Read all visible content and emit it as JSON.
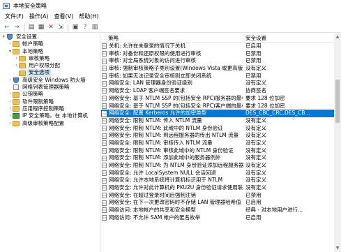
{
  "window": {
    "title": "本地安全策略"
  },
  "menu": [
    "文件(F)",
    "操作(A)",
    "查看(V)",
    "帮助(H)"
  ],
  "toolbar": [
    {
      "name": "back-button",
      "glyph": "←"
    },
    {
      "name": "forward-button",
      "glyph": "→"
    },
    {
      "name": "up-folder-button",
      "glyph": "▤"
    },
    {
      "name": "show-tree-button",
      "glyph": "▦"
    },
    {
      "name": "delete-button",
      "glyph": "✕"
    },
    {
      "name": "export-list-button",
      "glyph": "⇲"
    },
    {
      "name": "properties-button",
      "glyph": "▣"
    },
    {
      "name": "help-button",
      "glyph": "?"
    },
    {
      "name": "view-button",
      "glyph": "▥"
    }
  ],
  "tree": [
    {
      "label": "安全设置",
      "indent": 0,
      "arrow": "▾",
      "icon": "shield"
    },
    {
      "label": "帐户策略",
      "indent": 1,
      "arrow": "›",
      "icon": "folder"
    },
    {
      "label": "本地策略",
      "indent": 1,
      "arrow": "▾",
      "icon": "folder"
    },
    {
      "label": "审核策略",
      "indent": 2,
      "arrow": "›",
      "icon": "folder"
    },
    {
      "label": "用户权限分配",
      "indent": 2,
      "arrow": "›",
      "icon": "folder"
    },
    {
      "label": "安全选项",
      "indent": 2,
      "arrow": "",
      "icon": "folder",
      "selected": true
    },
    {
      "label": "高级安全 Windows 防火墙",
      "indent": 1,
      "arrow": "›",
      "icon": "shield"
    },
    {
      "label": "网络列表管理器策略",
      "indent": 1,
      "arrow": "",
      "icon": "doc"
    },
    {
      "label": "公钥策略",
      "indent": 1,
      "arrow": "›",
      "icon": "folder"
    },
    {
      "label": "软件限制策略",
      "indent": 1,
      "arrow": "›",
      "icon": "folder"
    },
    {
      "label": "应用程序控制策略",
      "indent": 1,
      "arrow": "›",
      "icon": "folder"
    },
    {
      "label": "IP 安全策略，在 本地计算机",
      "indent": 1,
      "arrow": "›",
      "icon": "net"
    },
    {
      "label": "高级审核策略配置",
      "indent": 1,
      "arrow": "›",
      "icon": "folder"
    }
  ],
  "columns": {
    "policy": "策略",
    "setting": "安全设置"
  },
  "rows": [
    {
      "policy": "关机: 允许在未登录的情况下关机",
      "setting": "已启用"
    },
    {
      "policy": "审核: 对备份和还原权限的使用进行审核",
      "setting": "已禁用"
    },
    {
      "policy": "审核: 对全局系统对象的访问进行审核",
      "setting": "已禁用"
    },
    {
      "policy": "审核: 强制审核策略子类别设置(Windows Vista 或更高版本)...",
      "setting": "没有定义"
    },
    {
      "policy": "审核: 如果无法记录安全审核则立即关闭系统",
      "setting": "已禁用"
    },
    {
      "policy": "网络安全: LAN 管理器身份验证级别",
      "setting": "没有定义"
    },
    {
      "policy": "网络安全: LDAP 客户端签名要求",
      "setting": "协商签名"
    },
    {
      "policy": "网络安全: 基于 NTLM SSP 的(包括安全 RPC)服务器的最小...",
      "setting": "要求 128 位加密"
    },
    {
      "policy": "网络安全: 基于 NTLM SSP 的(包括安全 RPC)客户端的最小...",
      "setting": "要求 128 位加密"
    },
    {
      "policy": "网络安全: 配置 Kerberos 允许的加密类型",
      "setting": "DES_CBC_CRC,DES_CB...",
      "selected": true
    },
    {
      "policy": "网络安全: 限制 NTLM: 传入 NTLM 流量",
      "setting": "没有定义"
    },
    {
      "policy": "网络安全: 限制 NTLM: 此域中的 NTLM 身份验证",
      "setting": "没有定义"
    },
    {
      "policy": "网络安全: 限制 NTLM: 到远程服务器的传出 NTLM 流量",
      "setting": "没有定义"
    },
    {
      "policy": "网络安全: 限制 NTLM: 审核传入 NTLM 流量",
      "setting": "没有定义"
    },
    {
      "policy": "网络安全: 限制 NTLM: 审核此域中的 NTLM 身份验证",
      "setting": "没有定义"
    },
    {
      "policy": "网络安全: 限制 NTLM: 添加此域中的服务器例外",
      "setting": "没有定义"
    },
    {
      "policy": "网络安全: 限制 NTLM: 为 NTLM 身份验证添加远程服务器...",
      "setting": "没有定义"
    },
    {
      "policy": "网络安全: 允许 LocalSystem NULL 会话回退",
      "setting": "没有定义"
    },
    {
      "policy": "网络安全: 允许本地系统将计算机标识用于 NTLM",
      "setting": "没有定义"
    },
    {
      "policy": "网络安全: 允许对此计算机的 PKU2U 身份验证请求使用联机...",
      "setting": "没有定义"
    },
    {
      "policy": "网络安全: 在超过登录时间后强制注销",
      "setting": "已禁用"
    },
    {
      "policy": "网络安全: 在下一次更改密码时不存储 LAN 管理器哈希值",
      "setting": "已启用"
    },
    {
      "policy": "网络访问: 本地帐户的共享和安全模型",
      "setting": "经典 - 对本地用户进行..."
    },
    {
      "policy": "网络访问: 不允许 SAM 帐户的匿名枚举",
      "setting": "已启用"
    }
  ]
}
